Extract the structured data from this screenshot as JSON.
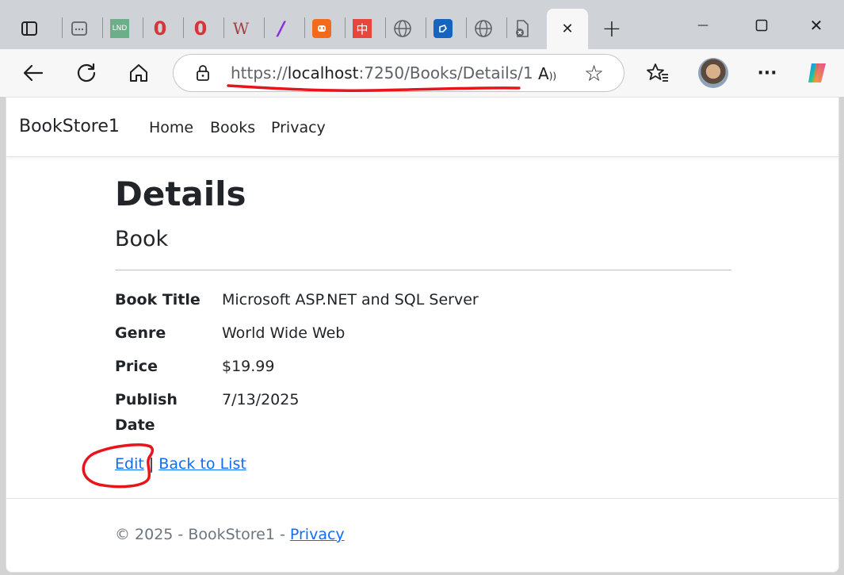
{
  "browser": {
    "tabs": [
      {
        "name": "workspace-icon"
      },
      {
        "name": "app-tab-icon"
      },
      {
        "name": "lnd-tab-icon",
        "text": "LND"
      },
      {
        "name": "opera-tab-icon-1",
        "text": "0"
      },
      {
        "name": "opera-tab-icon-2",
        "text": "0"
      },
      {
        "name": "w-tab-icon",
        "text": "W"
      },
      {
        "name": "slash-tab-icon",
        "text": "/"
      },
      {
        "name": "plug-tab-icon"
      },
      {
        "name": "zhong-tab-icon",
        "text": "中"
      },
      {
        "name": "globe-tab-icon-1"
      },
      {
        "name": "blue-tab-icon"
      },
      {
        "name": "globe-tab-icon-2"
      },
      {
        "name": "page-error-tab-icon"
      }
    ],
    "active_tab_close": "✕",
    "new_tab": "+",
    "window_controls": {
      "minimize": "—",
      "maximize": "☐",
      "close": "✕"
    },
    "url": {
      "scheme": "https://",
      "host": "localhost",
      "rest": ":7250/Books/Details/1"
    },
    "read_aloud": "A",
    "favorite": "☆",
    "more": "···"
  },
  "app": {
    "brand": "BookStore1",
    "nav": [
      "Home",
      "Books",
      "Privacy"
    ]
  },
  "page": {
    "title": "Details",
    "subtitle": "Book",
    "fields": [
      {
        "label": "Book Title",
        "value": "Microsoft ASP.NET and SQL Server"
      },
      {
        "label": "Genre",
        "value": "World Wide Web"
      },
      {
        "label": "Price",
        "value": "$19.99"
      },
      {
        "label": "Publish Date",
        "value": "7/13/2025"
      }
    ],
    "edit_link": "Edit",
    "separator": "|",
    "back_link": "Back to List"
  },
  "footer": {
    "text": "© 2025 - BookStore1 - ",
    "privacy": "Privacy"
  },
  "colors": {
    "link": "#0d6efd",
    "annotation": "#e8141c"
  }
}
